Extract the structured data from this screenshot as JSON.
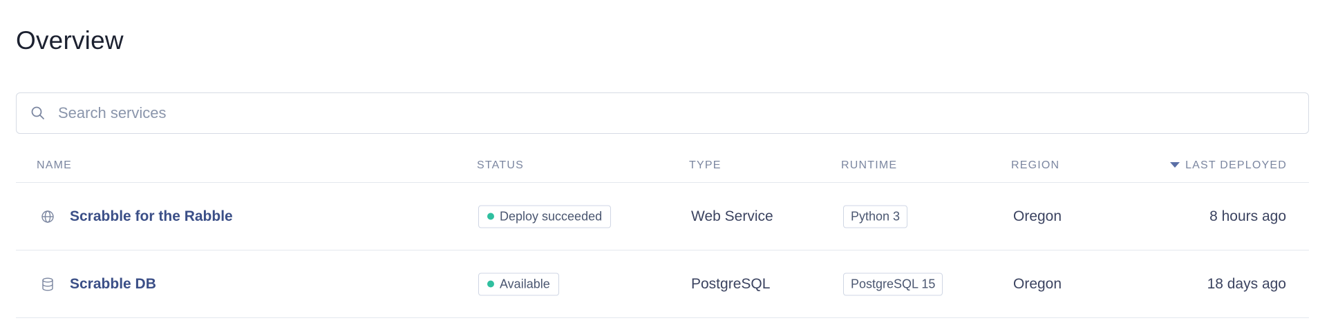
{
  "page": {
    "title": "Overview"
  },
  "search": {
    "placeholder": "Search services",
    "value": ""
  },
  "table": {
    "columns": {
      "name": "NAME",
      "status": "STATUS",
      "type": "TYPE",
      "runtime": "RUNTIME",
      "region": "REGION",
      "last_deployed": "LAST DEPLOYED"
    },
    "sort": {
      "column": "last_deployed",
      "direction": "desc",
      "icon": "caret-down-icon"
    },
    "rows": [
      {
        "icon": "globe-icon",
        "name": "Scrabble for the Rabble",
        "status": "Deploy succeeded",
        "status_color": "#2fbf9f",
        "type": "Web Service",
        "runtime": "Python 3",
        "region": "Oregon",
        "last_deployed": "8 hours ago"
      },
      {
        "icon": "database-icon",
        "name": "Scrabble DB",
        "status": "Available",
        "status_color": "#2fbf9f",
        "type": "PostgreSQL",
        "runtime": "PostgreSQL 15",
        "region": "Oregon",
        "last_deployed": "18 days ago"
      }
    ]
  },
  "colors": {
    "link": "#3b4f87",
    "accent": "#2fbf9f",
    "border": "#e3e7ee"
  }
}
